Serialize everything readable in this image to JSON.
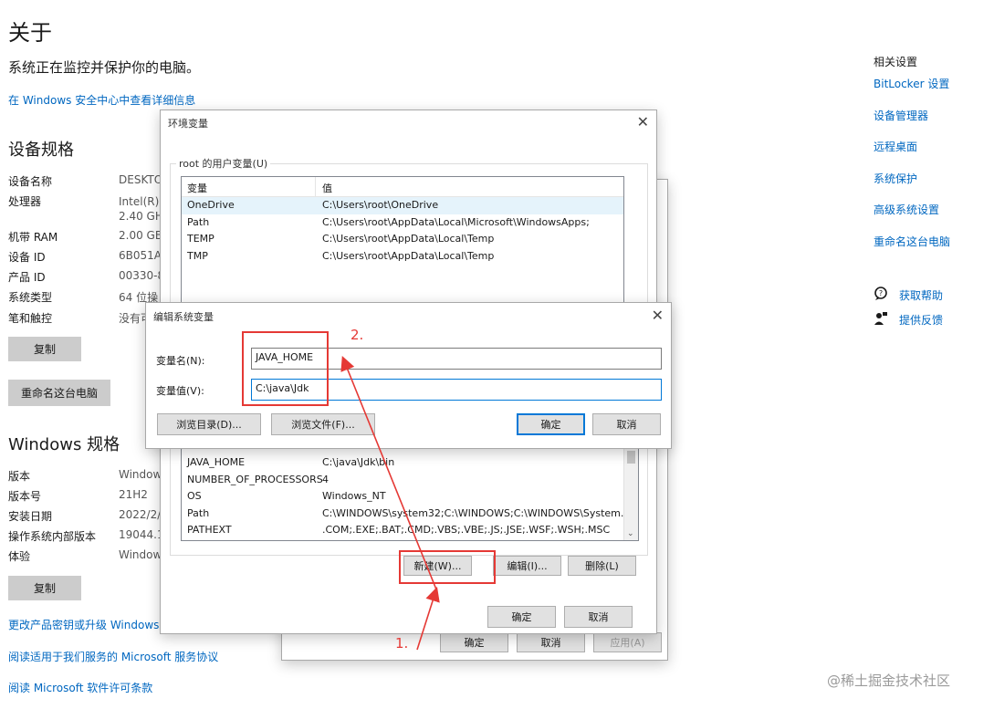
{
  "about": {
    "title": "关于",
    "protection_text": "系统正在监控并保护你的电脑。",
    "security_link": "在 Windows 安全中心中查看详细信息"
  },
  "device_specs": {
    "heading": "设备规格",
    "rows": [
      {
        "label": "设备名称",
        "value": "DESKTO"
      },
      {
        "label": "处理器",
        "value": "Intel(R) C",
        "value2": "2.40 GH"
      },
      {
        "label": "机带 RAM",
        "value": "2.00 GB"
      },
      {
        "label": "设备 ID",
        "value": "6B051A8"
      },
      {
        "label": "产品 ID",
        "value": "00330-8"
      },
      {
        "label": "系统类型",
        "value": "64 位操"
      },
      {
        "label": "笔和触控",
        "value": "没有可"
      }
    ],
    "copy_button": "复制",
    "rename_button": "重命名这台电脑"
  },
  "windows_specs": {
    "heading": "Windows 规格",
    "rows": [
      {
        "label": "版本",
        "value": "Window"
      },
      {
        "label": "版本号",
        "value": "21H2"
      },
      {
        "label": "安装日期",
        "value": "2022/2/"
      },
      {
        "label": "操作系统内部版本",
        "value": "19044.17"
      },
      {
        "label": "体验",
        "value": "Window"
      }
    ],
    "copy_button": "复制"
  },
  "footer_links": [
    "更改产品密钥或升级 Windows",
    "阅读适用于我们服务的 Microsoft 服务协议",
    "阅读 Microsoft 软件许可条款"
  ],
  "related": {
    "heading": "相关设置",
    "links": [
      "BitLocker 设置",
      "设备管理器",
      "远程桌面",
      "系统保护",
      "高级系统设置",
      "重命名这台电脑"
    ],
    "help": "获取帮助",
    "feedback": "提供反馈"
  },
  "env_dialog": {
    "title": "环境变量",
    "user_group_label": "root 的用户变量(U)",
    "col_var": "变量",
    "col_val": "值",
    "user_vars": [
      {
        "name": "OneDrive",
        "value": "C:\\Users\\root\\OneDrive"
      },
      {
        "name": "Path",
        "value": "C:\\Users\\root\\AppData\\Local\\Microsoft\\WindowsApps;"
      },
      {
        "name": "TEMP",
        "value": "C:\\Users\\root\\AppData\\Local\\Temp"
      },
      {
        "name": "TMP",
        "value": "C:\\Users\\root\\AppData\\Local\\Temp"
      }
    ],
    "system_vars": [
      {
        "name": "JAVA_HOME",
        "value": "C:\\java\\Jdk\\bin"
      },
      {
        "name": "NUMBER_OF_PROCESSORS",
        "value": "4"
      },
      {
        "name": "OS",
        "value": "Windows_NT"
      },
      {
        "name": "Path",
        "value": "C:\\WINDOWS\\system32;C:\\WINDOWS;C:\\WINDOWS\\System..."
      },
      {
        "name": "PATHEXT",
        "value": ".COM;.EXE;.BAT;.CMD;.VBS;.VBE;.JS;.JSE;.WSF;.WSH;.MSC"
      }
    ],
    "new_button": "新建(W)...",
    "edit_button": "编辑(I)...",
    "delete_button": "删除(L)",
    "ok_button": "确定",
    "cancel_button": "取消"
  },
  "behind_buttons": [
    "确定",
    "取消",
    "应用(A)"
  ],
  "edit_dialog": {
    "title": "编辑系统变量",
    "name_label": "变量名(N):",
    "name_value": "JAVA_HOME",
    "value_label": "变量值(V):",
    "value_value": "C:\\java\\Jdk",
    "browse_dir": "浏览目录(D)...",
    "browse_file": "浏览文件(F)...",
    "ok_button": "确定",
    "cancel_button": "取消"
  },
  "annotations": {
    "step1": "1.",
    "step2": "2."
  },
  "watermark": "@稀土掘金技术社区",
  "colors": {
    "link": "#0067c0",
    "annotation": "#e53935",
    "primary_border": "#0078d7"
  },
  "icons": {
    "help": "chat-question-icon",
    "feedback": "person-feedback-icon",
    "close": "close-icon"
  }
}
